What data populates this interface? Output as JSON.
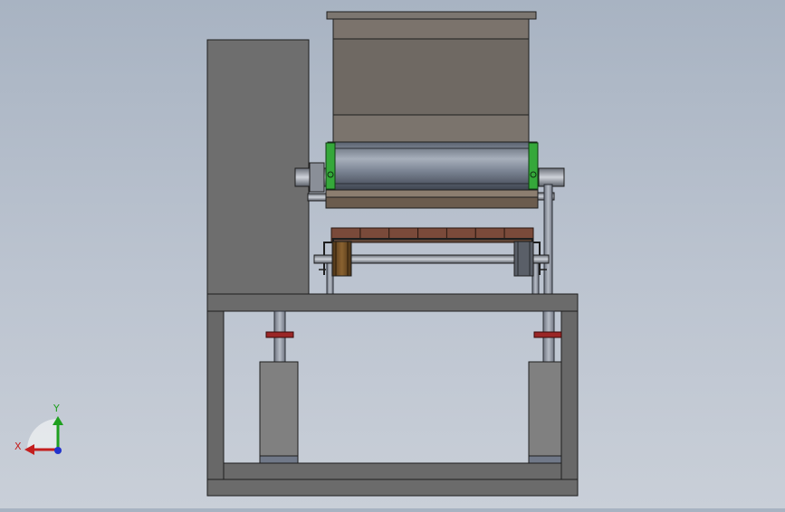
{
  "viewport": {
    "background_top": "#a8b3c2",
    "background_bottom": "#c9cfd8"
  },
  "triad": {
    "x_label": "X",
    "y_label": "Y",
    "x_color": "#c41e1e",
    "y_color": "#1fa01f",
    "z_color": "#2233cc"
  },
  "model": {
    "hopper_color": "#766f68",
    "cabinet_color": "#6e6e6e",
    "frame_color": "#6b6b6b",
    "roller_color": "#6d7582",
    "end_cap_color": "#35a83a",
    "brick_color": "#7a4a3a",
    "wheel_color": "#6b4a22",
    "collar_color": "#9b2626",
    "cylinder_color": "#808080"
  }
}
